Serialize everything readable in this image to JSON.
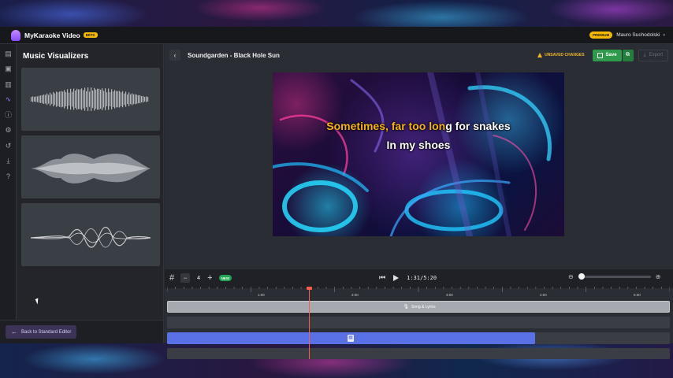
{
  "app": {
    "name": "MyKaraoke Video",
    "beta_badge": "BETA",
    "premium_badge": "PREMIUM",
    "user_name": "Mauro Suchodolski"
  },
  "rail": {
    "icons": [
      "text-icon",
      "image-icon",
      "book-icon",
      "waveform-icon",
      "info-icon",
      "gear-icon",
      "history-icon",
      "download-icon",
      "help-icon"
    ],
    "active": "waveform-icon"
  },
  "visualizers": {
    "title": "Music Visualizers",
    "items": [
      "waveform-bars-visualizer",
      "mirrored-wave-visualizer",
      "sine-lines-visualizer"
    ]
  },
  "footer": {
    "back_label": "Back to Standard Editor"
  },
  "editor": {
    "song_title": "Soundgarden - Black Hole Sun",
    "unsaved_label": "UNSAVED CHANGES",
    "save_label": "Save",
    "export_label": "Export"
  },
  "preview": {
    "line1_sung": "Sometimes, far too lon",
    "line1_rest": "g for snakes",
    "line2": "In my shoes",
    "accent_color": "#f7b21a"
  },
  "transport": {
    "step_value": "4",
    "new_badge": "NEW",
    "current_time": "1:31",
    "separator": " / ",
    "total_time": "5:20",
    "zoom_level": 0
  },
  "timeline": {
    "ruler_labels": [
      "1:00",
      "2:00",
      "3:00",
      "4:00",
      "5:00"
    ],
    "track1_label": "Song & Lyrics",
    "playhead_time": "1:31"
  }
}
